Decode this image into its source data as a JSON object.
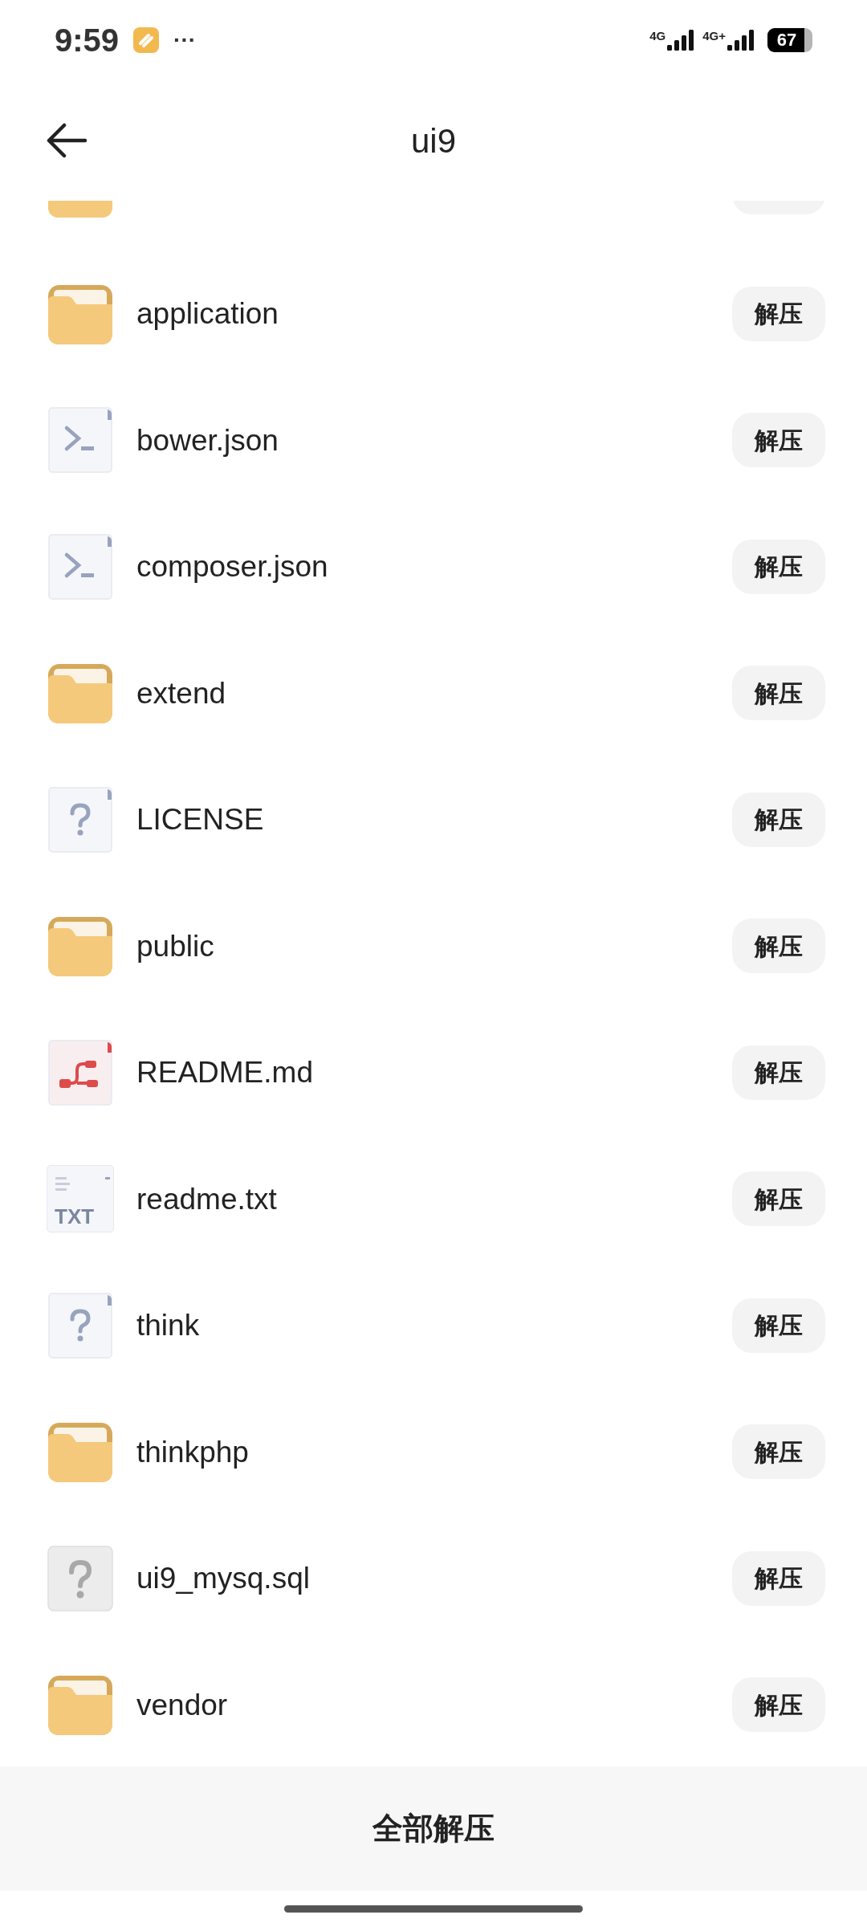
{
  "status_bar": {
    "time": "9:59",
    "more": "···",
    "network_1": "4G",
    "network_2": "4G+",
    "battery": "67"
  },
  "header": {
    "title": "ui9"
  },
  "partial_row": {
    "kind": "folder"
  },
  "files": [
    {
      "kind": "folder",
      "name": "application",
      "button": "解压"
    },
    {
      "kind": "script",
      "name": "bower.json",
      "button": "解压"
    },
    {
      "kind": "script",
      "name": "composer.json",
      "button": "解压"
    },
    {
      "kind": "folder",
      "name": "extend",
      "button": "解压"
    },
    {
      "kind": "unknown",
      "name": "LICENSE",
      "button": "解压"
    },
    {
      "kind": "folder",
      "name": "public",
      "button": "解压"
    },
    {
      "kind": "markdown",
      "name": "README.md",
      "button": "解压"
    },
    {
      "kind": "text",
      "name": "readme.txt",
      "icon_text": "TXT",
      "button": "解压"
    },
    {
      "kind": "unknown",
      "name": "think",
      "button": "解压"
    },
    {
      "kind": "folder",
      "name": "thinkphp",
      "button": "解压"
    },
    {
      "kind": "plain",
      "name": "ui9_mysq.sql",
      "button": "解压"
    },
    {
      "kind": "folder",
      "name": "vendor",
      "button": "解压"
    }
  ],
  "bottom_button": "全部解压"
}
